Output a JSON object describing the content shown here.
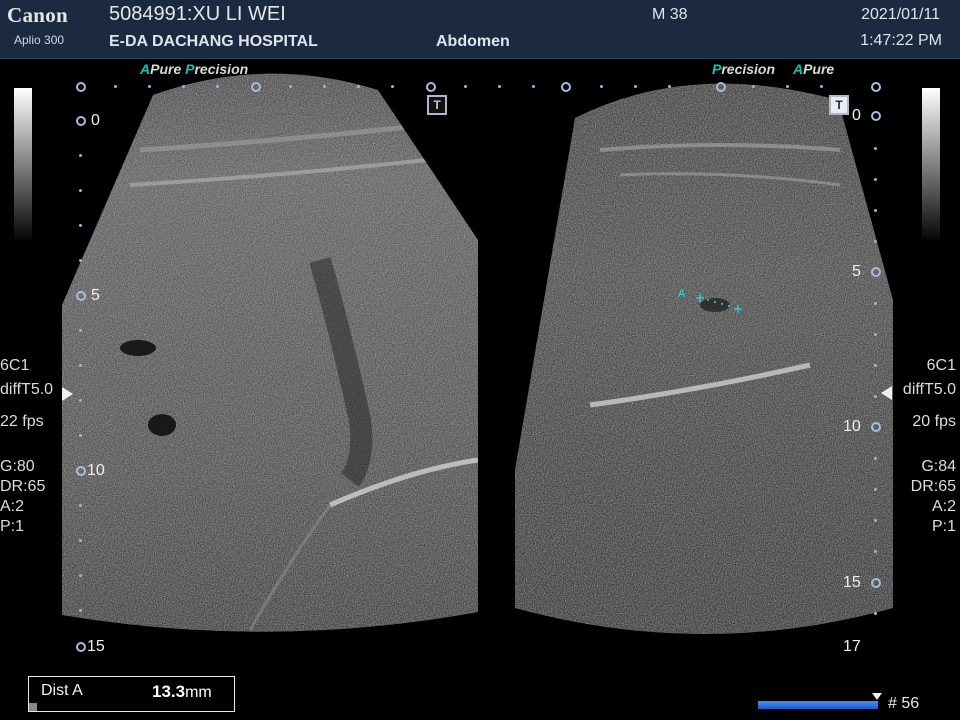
{
  "header": {
    "brand": "Canon",
    "model": "Aplio 300",
    "patient": "5084991:XU LI WEI",
    "hospital": "E-DA DACHANG HOSPITAL",
    "exam": "Abdomen",
    "age_marker": "M 38",
    "date": "2021/01/11",
    "time": "1:47:22 PM"
  },
  "left_panel": {
    "brand_a": "A",
    "brand_pure": "Pure",
    "brand_p": "P",
    "brand_precision": "recision",
    "transducer": "6C1",
    "filter": "diffT5.0",
    "fps": "22 fps",
    "gain": "G:80",
    "dynamic_range": "DR:65",
    "a": "A:2",
    "p": "P:1",
    "depth_labels": [
      "0",
      "5",
      "10",
      "15"
    ],
    "t_marker": "T"
  },
  "right_panel": {
    "brand_p": "P",
    "brand_precision": "recision",
    "brand_a": "A",
    "brand_pure": "Pure",
    "transducer": "6C1",
    "filter": "diffT5.0",
    "fps": "20 fps",
    "gain": "G:84",
    "dynamic_range": "DR:65",
    "a": "A:2",
    "p": "P:1",
    "depth_labels": [
      "0",
      "5",
      "10",
      "15",
      "17"
    ],
    "t_marker": "T",
    "caliper_label": "A"
  },
  "measurement": {
    "label": "Dist A",
    "value": "13.3",
    "unit": "mm"
  },
  "footer": {
    "frame": "# 56"
  },
  "colors": {
    "header_bg": "#1b2a40",
    "brand_accent": "#17c1b2",
    "caliper": "#36d9e0",
    "cine_bar": "#2f6fe0"
  }
}
